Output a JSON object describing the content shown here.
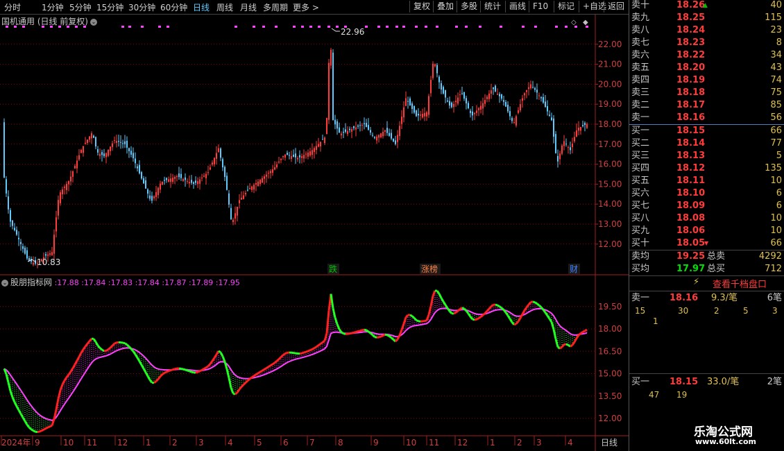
{
  "toolbar": {
    "periods": [
      "分时",
      "1分钟",
      "5分钟",
      "15分钟",
      "30分钟",
      "60分钟",
      "日线",
      "周线",
      "月线",
      "多周期",
      "更多 >"
    ],
    "active_period": "日线",
    "tools": [
      "复权",
      "叠加",
      "多股",
      "统计",
      "画线",
      "F10",
      "标记",
      "+自选",
      "返回"
    ]
  },
  "main_panel": {
    "title": "国机通用 (日线 前复权)",
    "high_label": "22.96",
    "low_label": "10.83",
    "price_axis": [
      "22.00",
      "21.00",
      "20.00",
      "19.00",
      "18.00",
      "17.00",
      "16.00",
      "15.00",
      "14.00",
      "13.00",
      "12.00"
    ],
    "event_markers": [
      {
        "text": "跌",
        "color": "#00c000"
      },
      {
        "text": "涨榜",
        "color": "#ff8040"
      },
      {
        "text": "财",
        "color": "#4080ff"
      }
    ]
  },
  "indicator_panel": {
    "title": "股朋指标网",
    "values": [
      ":17.88",
      ":17.84",
      ":17.83",
      ":17.84",
      ":17.87",
      ":17.89",
      ":17.95"
    ],
    "axis": [
      "19.50",
      "18.00",
      "16.50",
      "15.00",
      "13.50",
      "12.00"
    ]
  },
  "time_axis": {
    "labels": [
      "2024年",
      "9",
      "10",
      "11",
      "12",
      "1",
      "2",
      "3",
      "4",
      "5",
      "6",
      "7",
      "8",
      "9",
      "10",
      "11",
      "12",
      "1",
      "2",
      "3",
      "4"
    ],
    "period_label": "日线"
  },
  "order_book": {
    "asks": [
      {
        "label": "卖十",
        "price": "18.26",
        "vol": "40"
      },
      {
        "label": "卖九",
        "price": "18.25",
        "vol": "115"
      },
      {
        "label": "卖八",
        "price": "18.24",
        "vol": "23"
      },
      {
        "label": "卖七",
        "price": "18.23",
        "vol": "8"
      },
      {
        "label": "卖六",
        "price": "18.22",
        "vol": "34"
      },
      {
        "label": "卖五",
        "price": "18.20",
        "vol": "43"
      },
      {
        "label": "卖四",
        "price": "18.19",
        "vol": "74"
      },
      {
        "label": "卖三",
        "price": "18.18",
        "vol": "75"
      },
      {
        "label": "卖二",
        "price": "18.17",
        "vol": "85"
      },
      {
        "label": "卖一",
        "price": "18.16",
        "vol": "56"
      }
    ],
    "bids": [
      {
        "label": "买一",
        "price": "18.15",
        "vol": "66"
      },
      {
        "label": "买二",
        "price": "18.14",
        "vol": "77"
      },
      {
        "label": "买三",
        "price": "18.13",
        "vol": "5"
      },
      {
        "label": "买四",
        "price": "18.12",
        "vol": "135"
      },
      {
        "label": "买五",
        "price": "18.11",
        "vol": "10"
      },
      {
        "label": "买六",
        "price": "18.10",
        "vol": "6"
      },
      {
        "label": "买七",
        "price": "18.09",
        "vol": "6"
      },
      {
        "label": "买八",
        "price": "18.08",
        "vol": "10"
      },
      {
        "label": "买九",
        "price": "18.06",
        "vol": "10"
      },
      {
        "label": "买十",
        "price": "18.05",
        "vol": "66"
      }
    ],
    "sell_avg_label": "卖均",
    "sell_avg": "19.25",
    "total_sell_label": "总卖",
    "total_sell": "4292",
    "buy_avg_label": "买均",
    "buy_avg": "17.97",
    "total_buy_label": "总买",
    "total_buy": "712"
  },
  "deep_book": {
    "link": "查看千档盘口",
    "ask1": {
      "label": "卖一",
      "price": "18.16",
      "per": "9.3/笔",
      "count": "6笔",
      "orders": [
        "15",
        "30",
        "2",
        "5",
        "3",
        "1"
      ]
    },
    "bid1": {
      "label": "买一",
      "price": "18.15",
      "per": "33.0/笔",
      "count": "2笔",
      "orders": [
        "47",
        "19"
      ]
    }
  },
  "watermark": {
    "title": "乐淘公式网",
    "url": "www.60lt.com"
  },
  "colors": {
    "up": "#ff3b3b",
    "down": "#5ecbff",
    "green": "#00ff00",
    "magenta": "#ff40ff",
    "grid": "#8b0000"
  }
}
